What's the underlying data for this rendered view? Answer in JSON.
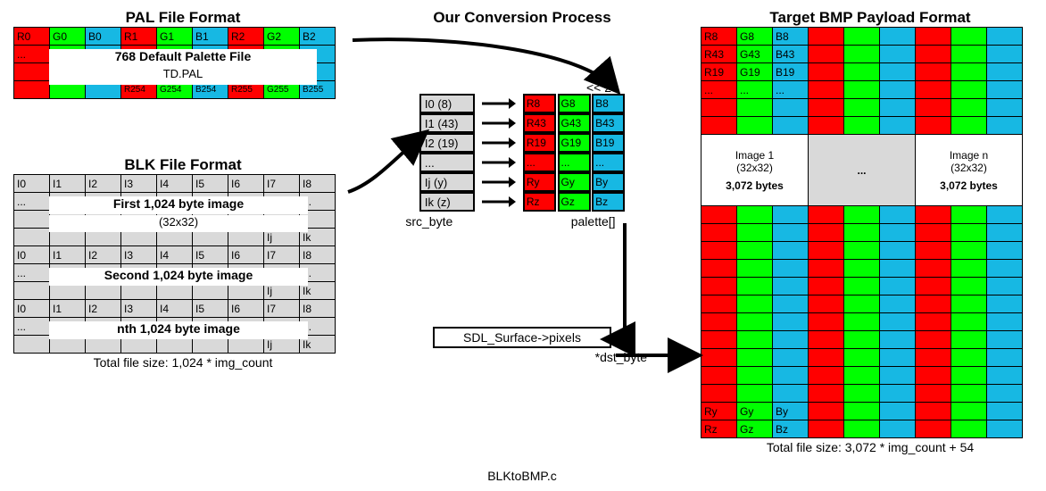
{
  "titles": {
    "pal": "PAL File Format",
    "blk": "BLK File Format",
    "conv": "Our Conversion Process",
    "bmp": "Target BMP Payload Format"
  },
  "pal": {
    "row0": [
      "R0",
      "G0",
      "B0",
      "R1",
      "G1",
      "B1",
      "R2",
      "G2",
      "B2"
    ],
    "row1": "...",
    "row3": [
      "R254",
      "G254",
      "B254",
      "R255",
      "G255",
      "B255"
    ],
    "overlay1": "768 Default Palette File",
    "overlay2": "TD.PAL"
  },
  "blk": {
    "header": [
      "I0",
      "I1",
      "I2",
      "I3",
      "I4",
      "I5",
      "I6",
      "I7",
      "I8"
    ],
    "ij": "Ij",
    "ik": "Ik",
    "dots": "...",
    "img1": "First 1,024 byte image",
    "img2": "Second 1,024 byte image",
    "imgn": "nth 1,024 byte image",
    "size": "(32x32)",
    "total": "Total file size: 1,024 * img_count"
  },
  "conv": {
    "shift": "<< 2",
    "src": [
      "I0 (8)",
      "I1 (43)",
      "I2 (19)",
      "...",
      "Ij (y)",
      "Ik (z)"
    ],
    "pal": [
      [
        "R8",
        "G8",
        "B8"
      ],
      [
        "R43",
        "G43",
        "B43"
      ],
      [
        "R19",
        "G19",
        "B19"
      ],
      [
        "...",
        "...",
        "..."
      ],
      [
        "Ry",
        "Gy",
        "By"
      ],
      [
        "Rz",
        "Gz",
        "Bz"
      ]
    ],
    "srclabel": "src_byte",
    "pallabel": "palette[]",
    "sdl": "SDL_Surface->pixels",
    "dstlabel": "*dst_byte",
    "file": "BLKtoBMP.c"
  },
  "bmp": {
    "rowA": [
      "R8",
      "G8",
      "B8"
    ],
    "rowB": [
      "R43",
      "G43",
      "B43"
    ],
    "rowC": [
      "R19",
      "G19",
      "B19"
    ],
    "rowDots": "...",
    "rowY": [
      "Ry",
      "Gy",
      "By"
    ],
    "rowZ": [
      "Rz",
      "Gz",
      "Bz"
    ],
    "blk1a": "Image 1",
    "blk1b": "(32x32)",
    "blk1c": "3,072 bytes",
    "midsep": "...",
    "blkna": "Image n",
    "blknb": "(32x32)",
    "blknc": "3,072 bytes",
    "total": "Total file size: 3,072 * img_count + 54"
  }
}
